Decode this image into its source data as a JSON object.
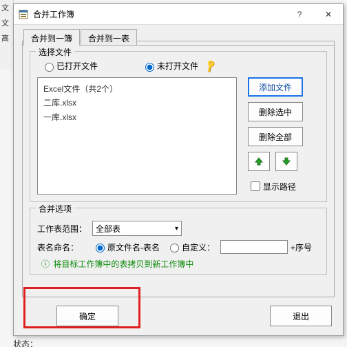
{
  "window": {
    "title": "合并工作簿",
    "help": "?",
    "close": "✕"
  },
  "tabs": {
    "merge_to_book": "合并到一簿",
    "merge_to_sheet": "合并到一表"
  },
  "select_files": {
    "legend": "选择文件",
    "opened_files": "已打开文件",
    "unopened_files": "未打开文件",
    "listing_header": "Excel文件（共2个）",
    "file1": "二库.xlsx",
    "file2": "一库.xlsx",
    "add_file": "添加文件",
    "remove_selected": "删除选中",
    "remove_all": "删除全部",
    "show_path": "显示路径"
  },
  "merge_options": {
    "legend": "合并选项",
    "sheet_scope_label": "工作表范围：",
    "sheet_scope_value": "全部表",
    "name_label": "表名命名：",
    "name_radio1": "原文件名-表名",
    "name_radio2": "自定义：",
    "suffix": "+序号",
    "tip": "将目标工作簿中的表拷贝到新工作簿中"
  },
  "buttons": {
    "ok": "确定",
    "exit": "退出"
  },
  "status": "状态："
}
